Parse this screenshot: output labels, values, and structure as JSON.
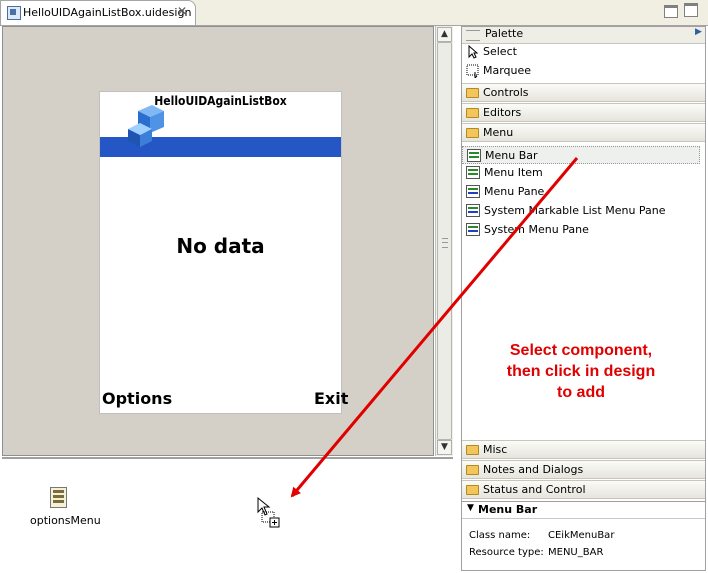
{
  "editor": {
    "tab_label": "HelloUIDAgainListBox.uidesign",
    "tab_close": "✕"
  },
  "phone": {
    "title": "HelloUIDAgainListBox",
    "body_text": "No data",
    "left_softkey": "Options",
    "right_softkey": "Exit"
  },
  "tray": {
    "components": [
      {
        "label": "optionsMenu",
        "icon": "menu-bar-component-icon"
      }
    ]
  },
  "palette": {
    "title": "Palette",
    "tools": [
      {
        "label": "Select",
        "icon": "arrow-cursor-icon"
      },
      {
        "label": "Marquee",
        "icon": "marquee-icon"
      }
    ],
    "drawers_top": [
      "Controls",
      "Editors",
      "Menu"
    ],
    "menu_items": [
      {
        "label": "Menu Bar"
      },
      {
        "label": "Menu Item"
      },
      {
        "label": "Menu Pane"
      },
      {
        "label": "System Markable List Menu Pane"
      },
      {
        "label": "System Menu Pane"
      }
    ],
    "drawers_bottom": [
      "Misc",
      "Notes and Dialogs",
      "Status and Control"
    ]
  },
  "properties": {
    "title": "Menu Bar",
    "class_label": "Class name:",
    "class_value": "CEikMenuBar",
    "resource_label": "Resource type:",
    "resource_value": "MENU_BAR"
  },
  "annotation": {
    "line1": "Select component,",
    "line2": "then click in design",
    "line3": "to add",
    "color": "#e00000"
  }
}
